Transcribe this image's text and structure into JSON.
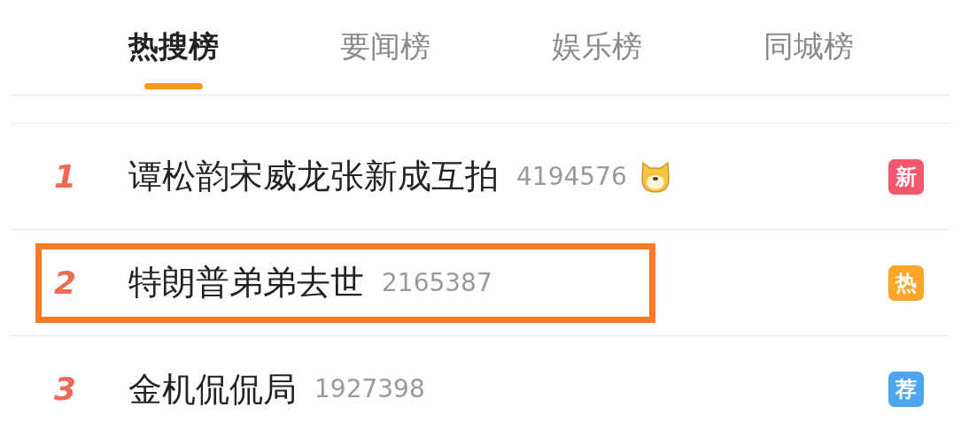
{
  "tabs": [
    {
      "label": "热搜榜",
      "selected": true
    },
    {
      "label": "要闻榜",
      "selected": false
    },
    {
      "label": "娱乐榜",
      "selected": false
    },
    {
      "label": "同城榜",
      "selected": false
    }
  ],
  "items": [
    {
      "rank": "1",
      "title": "谭松韵宋威龙张新成互拍",
      "count": "4194576",
      "emoji": true,
      "badge": "新",
      "color": "#f2596f",
      "highlighted": false
    },
    {
      "rank": "2",
      "title": "特朗普弟弟去世",
      "count": "2165387",
      "emoji": false,
      "badge": "热",
      "color": "#fba52a",
      "highlighted": true
    },
    {
      "rank": "3",
      "title": "金机侃侃局",
      "count": "1927398",
      "emoji": false,
      "badge": "荐",
      "color": "#4fa6f0",
      "highlighted": false
    }
  ]
}
